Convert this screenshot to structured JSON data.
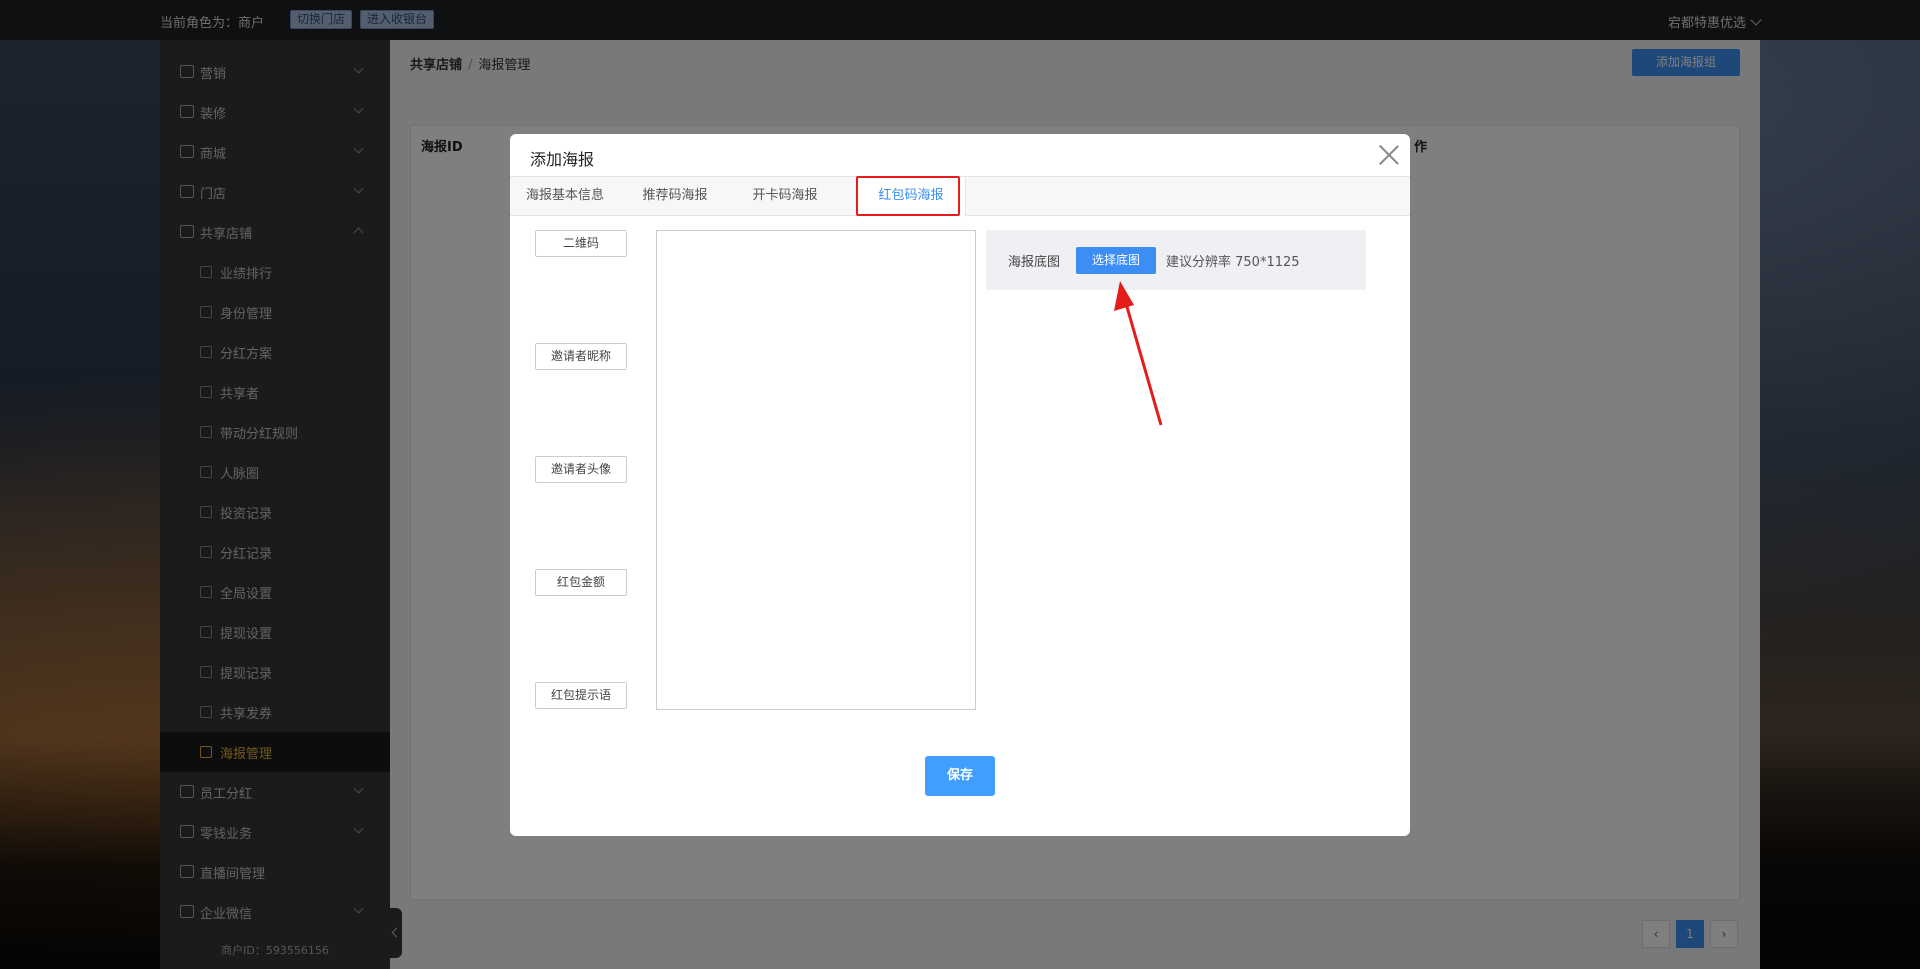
{
  "topbar": {
    "role_text": "当前角色为：商户",
    "switch_store": "切换门店",
    "enter_cashier": "进入收银台",
    "account": "宕都特惠优选"
  },
  "sidebar": {
    "items": [
      {
        "label": "营销",
        "icon": "marketing-icon"
      },
      {
        "label": "装修",
        "icon": "decor-icon"
      },
      {
        "label": "商城",
        "icon": "mall-icon"
      },
      {
        "label": "门店",
        "icon": "store-icon"
      },
      {
        "label": "共享店铺",
        "icon": "shared-store-icon"
      }
    ],
    "sub_items": [
      {
        "label": "业绩排行"
      },
      {
        "label": "身份管理"
      },
      {
        "label": "分红方案"
      },
      {
        "label": "共享者"
      },
      {
        "label": "带动分红规则"
      },
      {
        "label": "人脉圈"
      },
      {
        "label": "投资记录"
      },
      {
        "label": "分红记录"
      },
      {
        "label": "全局设置"
      },
      {
        "label": "提现设置"
      },
      {
        "label": "提现记录"
      },
      {
        "label": "共享发券"
      },
      {
        "label": "海报管理"
      }
    ],
    "bottom_items": [
      {
        "label": "员工分红"
      },
      {
        "label": "零钱业务"
      },
      {
        "label": "直播间管理"
      },
      {
        "label": "企业微信"
      }
    ],
    "merchant_id": "商户ID：593556156"
  },
  "main": {
    "breadcrumb_1": "共享店铺",
    "breadcrumb_2": "海报管理",
    "add_group": "添加海报组",
    "col_poster_id": "海报ID",
    "col_right_partial": "作",
    "page_current": "1"
  },
  "modal": {
    "title": "添加海报",
    "tabs": [
      "海报基本信息",
      "推荐码海报",
      "开卡码海报",
      "红包码海报"
    ],
    "active_tab": "红包码海报",
    "fields": [
      "二维码",
      "邀请者昵称",
      "邀请者头像",
      "红包金额",
      "红包提示语"
    ],
    "bg_label": "海报底图",
    "choose_bg": "选择底图",
    "resolution_hint": "建议分辨率 750*1125",
    "save": "保存"
  },
  "colors": {
    "primary": "#3c8ef5",
    "highlight": "#e51c1c",
    "active_menu": "#e4b43c"
  }
}
